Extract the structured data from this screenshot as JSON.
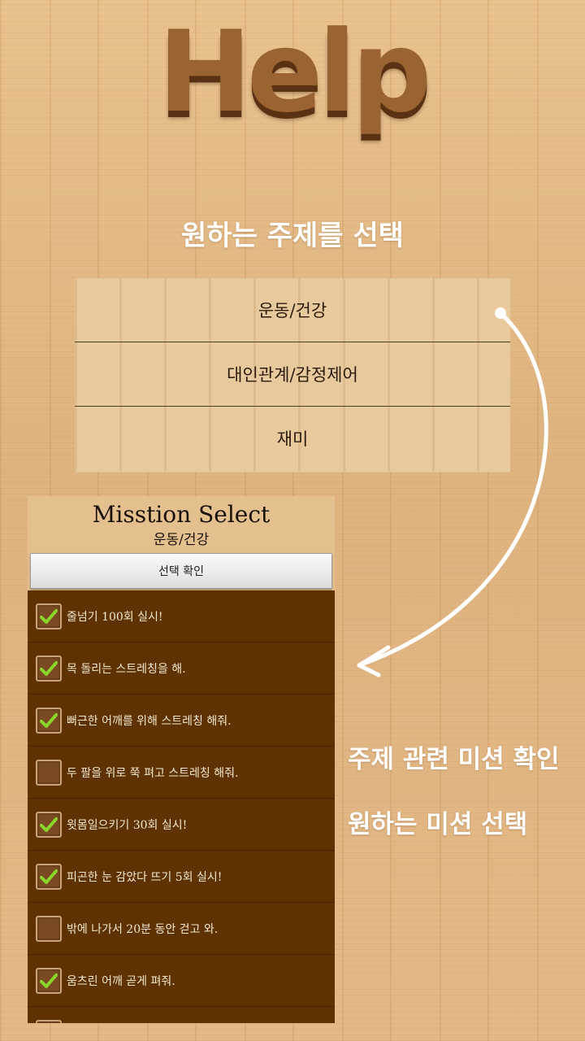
{
  "help_title": "Help",
  "subject_heading": "원하는 주제를 선택",
  "topics": [
    {
      "label": "운동/건강"
    },
    {
      "label": "대인관계/감정제어"
    },
    {
      "label": "재미"
    }
  ],
  "mission_panel": {
    "title": "Misstion Select",
    "subtitle": "운동/건강",
    "confirm_label": "선택 확인",
    "items": [
      {
        "text": "줄넘기 100회 실시!",
        "checked": true
      },
      {
        "text": "목 돌리는 스트레칭을 해.",
        "checked": true
      },
      {
        "text": "뻐근한 어깨를 위해 스트레칭 해줘.",
        "checked": true
      },
      {
        "text": "두 팔을 위로 쭉 펴고 스트레칭 해줘.",
        "checked": false
      },
      {
        "text": "윗몸일으키기 30회 실시!",
        "checked": true
      },
      {
        "text": "피곤한 눈 감았다 뜨기 5회 실시!",
        "checked": true
      },
      {
        "text": "밖에 나가서 20분 동안 걷고 와.",
        "checked": false
      },
      {
        "text": "움츠린 어깨 곧게 펴줘.",
        "checked": true
      }
    ]
  },
  "captions": {
    "line1": "주제 관련 미션 확인",
    "line2": "원하는 미션 선택"
  },
  "colors": {
    "list_background": "#5e3301",
    "check_green": "#8bd62a",
    "title_brown": "#9a6432"
  },
  "icons": {
    "check": "checkmark-icon",
    "arrow": "curved-arrow-icon"
  }
}
